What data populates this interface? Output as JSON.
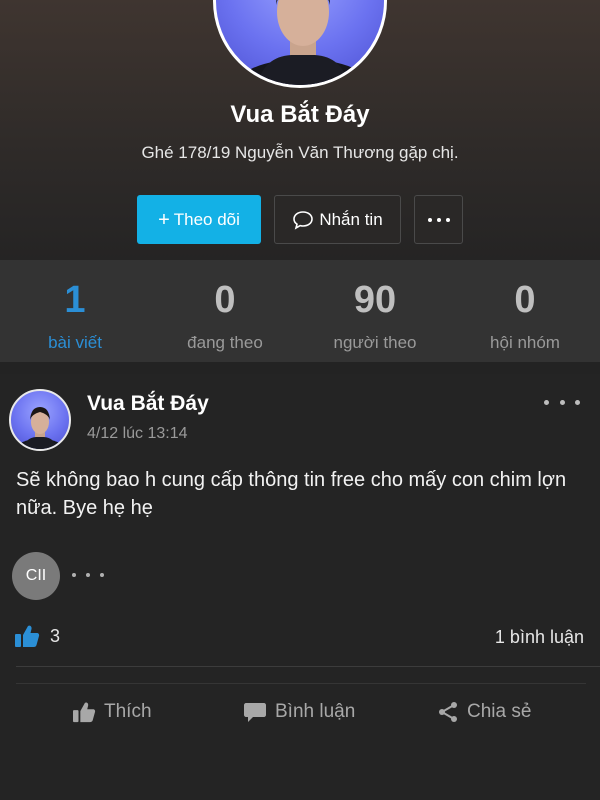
{
  "profile": {
    "name": "Vua Bắt Đáy",
    "bio": "Ghé 178/19 Nguyễn Văn Thương gặp chị.",
    "follow_button": "Theo dõi",
    "message_button": "Nhắn tin",
    "accent_color": "#13b1e6"
  },
  "stats": [
    {
      "value": "1",
      "label": "bài viết"
    },
    {
      "value": "0",
      "label": "đang theo"
    },
    {
      "value": "90",
      "label": "người theo"
    },
    {
      "value": "0",
      "label": "hội nhóm"
    }
  ],
  "post": {
    "author": "Vua Bắt Đáy",
    "time": "4/12 lúc 13:14",
    "text": "Sẽ không bao h cung cấp thông tin free cho mấy con chim lợn nữa. Bye hẹ hẹ",
    "reactor_initials": "CII",
    "like_count": "3",
    "comment_count": "1 bình luận",
    "actions": {
      "like": "Thích",
      "comment": "Bình luận",
      "share": "Chia sẻ"
    }
  },
  "icons": [
    "plus-icon",
    "chat-bubble-icon",
    "more-dots-icon",
    "thumbs-up-icon",
    "comment-icon",
    "share-icon"
  ]
}
